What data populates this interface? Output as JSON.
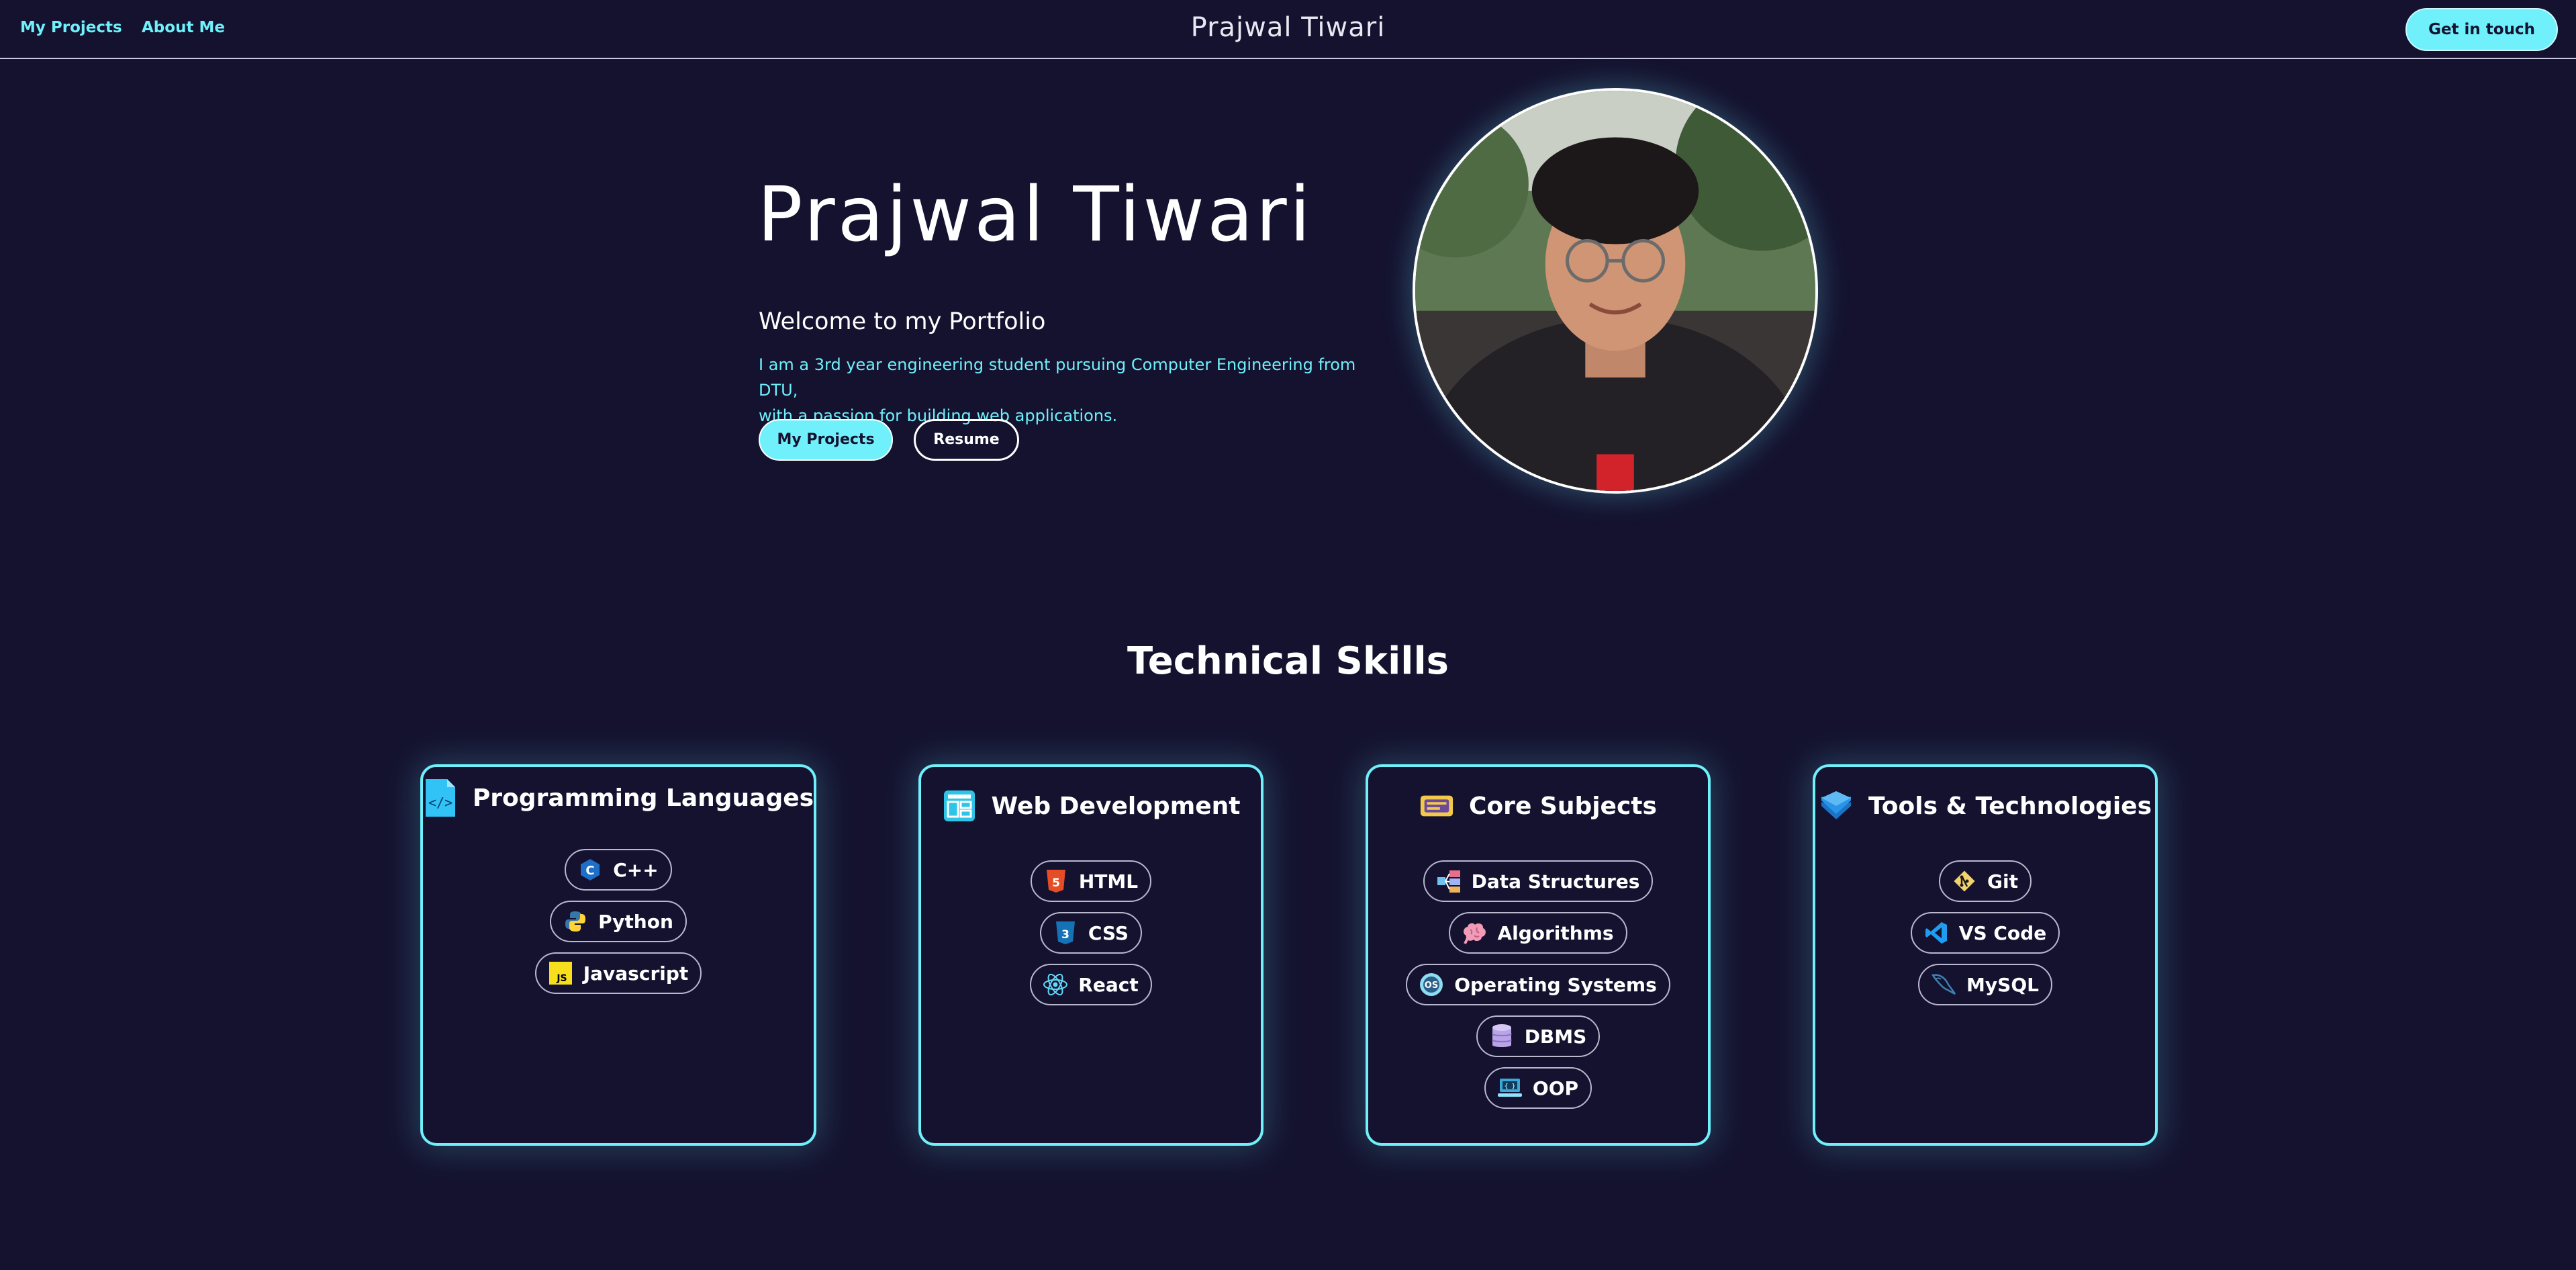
{
  "nav": {
    "projects_label": "My Projects",
    "about_label": "About Me",
    "brand": "Prajwal Tiwari",
    "cta_label": "Get in touch"
  },
  "hero": {
    "name": "Prajwal Tiwari",
    "welcome": "Welcome to my Portfolio",
    "bio_line1": "I am a 3rd year engineering student pursuing Computer Engineering from DTU,",
    "bio_line2": "with a passion for building web applications.",
    "primary_button": "My Projects",
    "secondary_button": "Resume",
    "photo_icon": "profile-photo"
  },
  "skills": {
    "title": "Technical Skills",
    "cards": [
      {
        "title": "Programming Languages",
        "icon": "code-file-icon",
        "items": [
          {
            "label": "C++",
            "icon": "cpp-icon"
          },
          {
            "label": "Python",
            "icon": "python-icon"
          },
          {
            "label": "Javascript",
            "icon": "javascript-icon"
          }
        ]
      },
      {
        "title": "Web Development",
        "icon": "web-layout-icon",
        "items": [
          {
            "label": "HTML",
            "icon": "html5-icon"
          },
          {
            "label": "CSS",
            "icon": "css3-icon"
          },
          {
            "label": "React",
            "icon": "react-icon"
          }
        ]
      },
      {
        "title": "Core Subjects",
        "icon": "ticket-icon",
        "items": [
          {
            "label": "Data Structures",
            "icon": "data-structures-icon"
          },
          {
            "label": "Algorithms",
            "icon": "brain-icon"
          },
          {
            "label": "Operating Systems",
            "icon": "os-icon"
          },
          {
            "label": "DBMS",
            "icon": "database-icon"
          },
          {
            "label": "OOP",
            "icon": "oop-icon"
          }
        ]
      },
      {
        "title": "Tools & Technologies",
        "icon": "stack-layers-icon",
        "items": [
          {
            "label": "Git",
            "icon": "git-icon"
          },
          {
            "label": "VS Code",
            "icon": "vscode-icon"
          },
          {
            "label": "MySQL",
            "icon": "mysql-icon"
          }
        ]
      }
    ]
  },
  "colors": {
    "background": "#14122f",
    "accent": "#6ff0fb",
    "text": "#ffffff"
  }
}
